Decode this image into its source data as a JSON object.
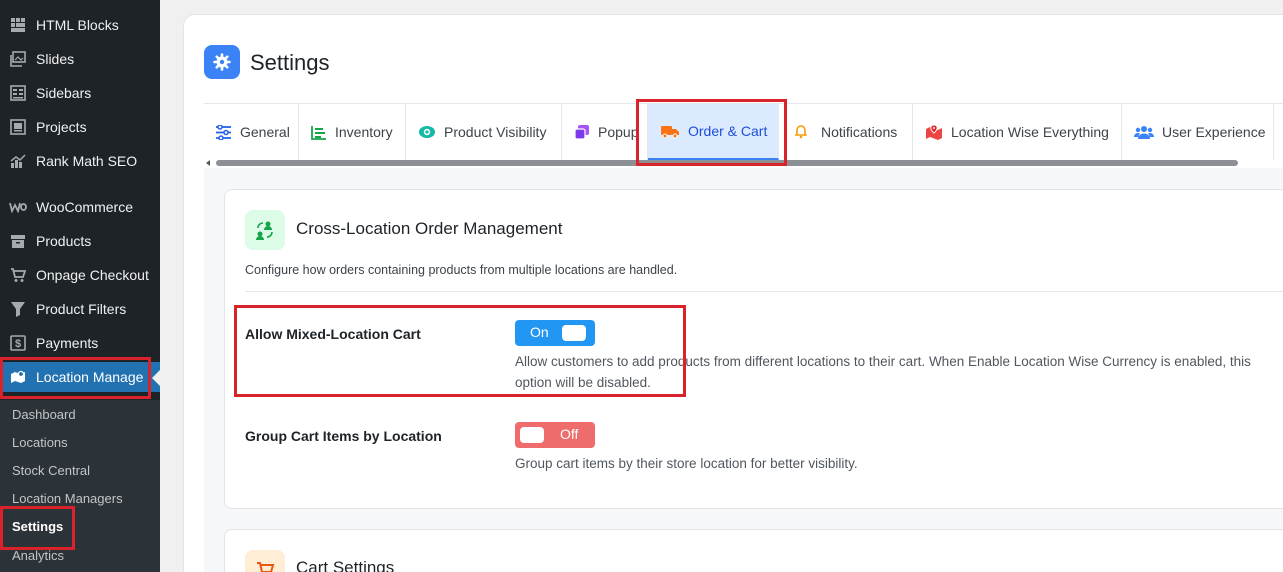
{
  "sidebar": {
    "items": [
      {
        "label": "HTML Blocks",
        "icon": "grid-icon"
      },
      {
        "label": "Slides",
        "icon": "images-icon"
      },
      {
        "label": "Sidebars",
        "icon": "layout-icon"
      },
      {
        "label": "Projects",
        "icon": "portfolio-icon"
      },
      {
        "label": "Rank Math SEO",
        "icon": "chart-icon"
      },
      {
        "label": "WooCommerce",
        "icon": "woo-icon"
      },
      {
        "label": "Products",
        "icon": "archive-icon"
      },
      {
        "label": "Onpage Checkout",
        "icon": "cart-icon"
      },
      {
        "label": "Product Filters",
        "icon": "filter-icon"
      },
      {
        "label": "Payments",
        "icon": "dollar-icon"
      },
      {
        "label": "Location Manage",
        "icon": "map-icon"
      }
    ],
    "submenu": [
      "Dashboard",
      "Locations",
      "Stock Central",
      "Location Managers",
      "Settings",
      "Analytics"
    ]
  },
  "page": {
    "title": "Settings"
  },
  "tabs": [
    {
      "label": "General",
      "icon": "sliders-icon"
    },
    {
      "label": "Inventory",
      "icon": "bar-chart-icon"
    },
    {
      "label": "Product Visibility",
      "icon": "eye-icon"
    },
    {
      "label": "Popup",
      "icon": "popup-icon"
    },
    {
      "label": "Order & Cart",
      "icon": "truck-icon"
    },
    {
      "label": "Notifications",
      "icon": "bell-icon"
    },
    {
      "label": "Location Wise Everything",
      "icon": "map-marker-icon"
    },
    {
      "label": "User Experience",
      "icon": "users-icon"
    }
  ],
  "cross_location": {
    "title": "Cross-Location Order Management",
    "description": "Configure how orders containing products from multiple locations are handled.",
    "settings": [
      {
        "label": "Allow Mixed-Location Cart",
        "toggle": "On",
        "help_line1": "Allow customers to add products from different locations to their cart. When Enable Location Wise Currency is enabled, this",
        "help_line2": "option will be disabled."
      },
      {
        "label": "Group Cart Items by Location",
        "toggle": "Off",
        "help_line1": "Group cart items by their store location for better visibility."
      }
    ]
  },
  "cart_settings": {
    "title": "Cart Settings"
  },
  "colors": {
    "accent": "#2271b1",
    "tab_active": "#1d4ed8",
    "toggle_on": "#2196f3",
    "toggle_off": "#ef6c6c",
    "highlight": "#d9222a"
  }
}
